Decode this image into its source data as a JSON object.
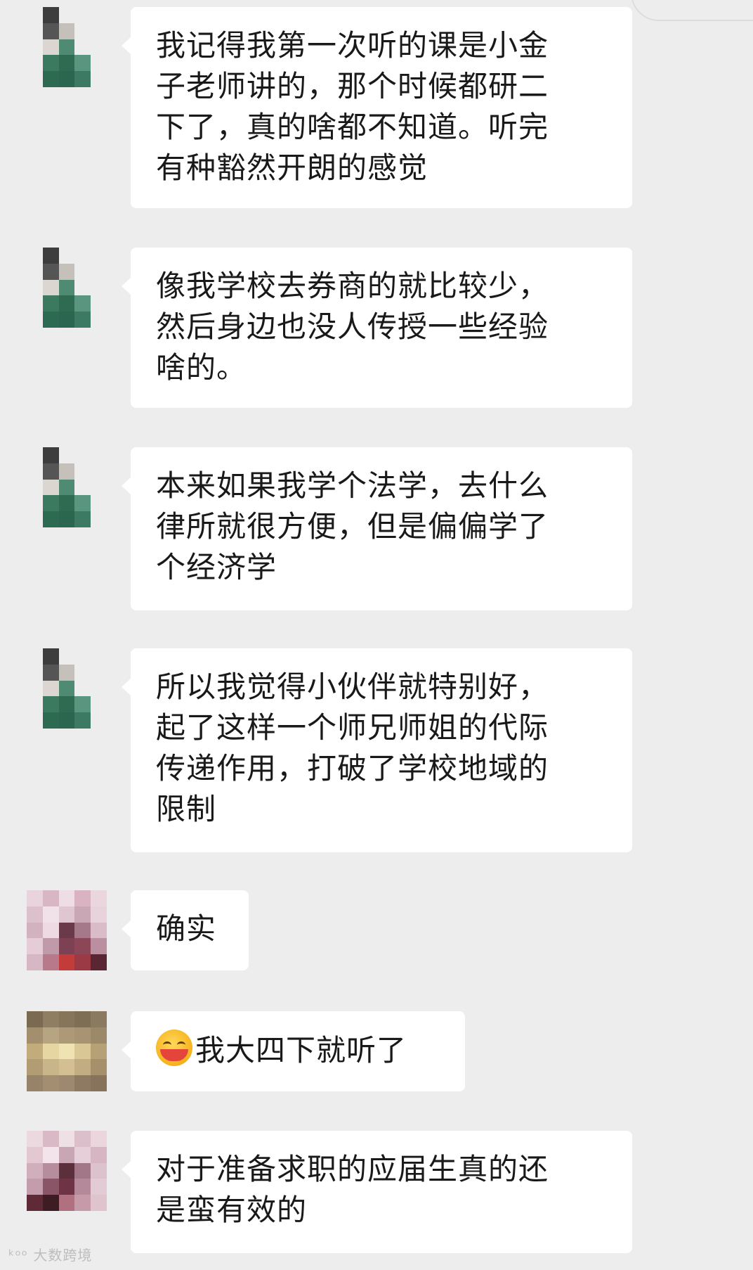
{
  "messages": [
    {
      "text": "我记得我第一次听的课是小金\n子老师讲的，那个时候都研二\n下了，真的啥都不知道。听完\n有种豁然开朗的感觉",
      "avatar": "avatar-green-1"
    },
    {
      "text": "像我学校去券商的就比较少，\n然后身边也没人传授一些经验\n啥的。",
      "avatar": "avatar-green-1"
    },
    {
      "text": "本来如果我学个法学，去什么\n律所就很方便，但是偏偏学了\n个经济学",
      "avatar": "avatar-green-1"
    },
    {
      "text": "所以我觉得小伙伴就特别好，\n起了这样一个师兄师姐的代际\n传递作用，打破了学校地域的\n限制",
      "avatar": "avatar-green-1"
    },
    {
      "text": "确实",
      "avatar": "avatar-pink-1"
    },
    {
      "text": "我大四下就听了",
      "emoji": "grinning-face-emoji",
      "avatar": "avatar-beige-1"
    },
    {
      "text": "对于准备求职的应届生真的还\n是蛮有效的",
      "avatar": "avatar-pink-2"
    }
  ],
  "watermark": "ᵏᵒᵒ 大数跨境",
  "colors": {
    "background": "#ededed",
    "bubble": "#ffffff",
    "text": "#191919"
  }
}
